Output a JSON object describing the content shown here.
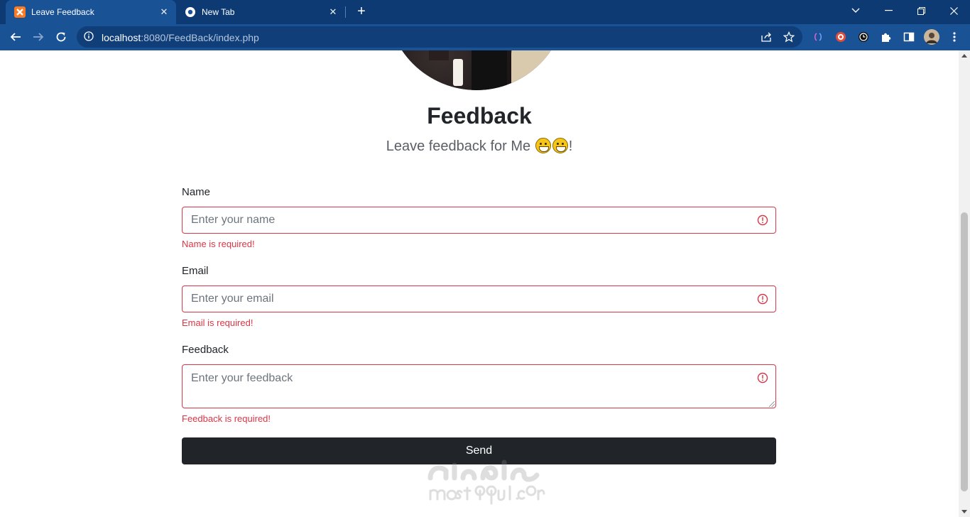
{
  "browser": {
    "tabs": [
      {
        "title": "Leave Feedback",
        "active": true,
        "favicon": "xampp-icon"
      },
      {
        "title": "New Tab",
        "active": false,
        "favicon": "chrome-icon"
      }
    ],
    "url": {
      "host": "localhost",
      "rest": ":8080/FeedBack/index.php"
    },
    "theme_color": "#0d3a73",
    "toolbar_color": "#1a5296"
  },
  "page": {
    "title": "Feedback",
    "subtitle_text": "Leave feedback for Me",
    "subtitle_suffix": "!",
    "form": {
      "name": {
        "label": "Name",
        "placeholder": "Enter your name",
        "error": "Name is required!"
      },
      "email": {
        "label": "Email",
        "placeholder": "Enter your email",
        "error": "Email is required!"
      },
      "feedback": {
        "label": "Feedback",
        "placeholder": "Enter your feedback",
        "error": "Feedback is required!"
      },
      "submit_label": "Send"
    },
    "error_color": "#dc3545",
    "button_color": "#212529"
  }
}
